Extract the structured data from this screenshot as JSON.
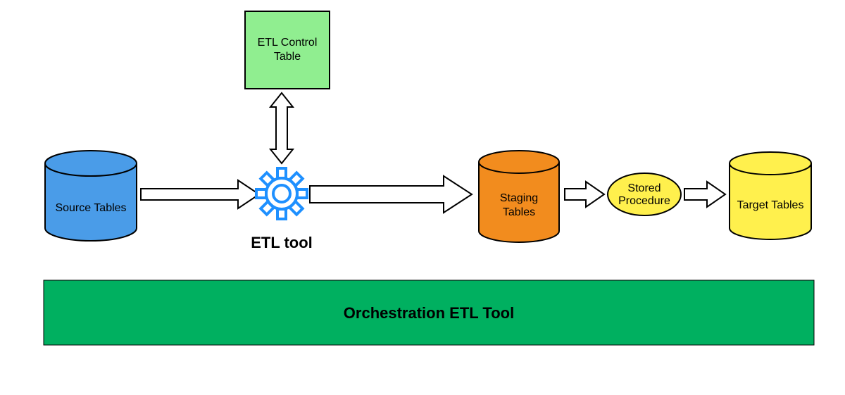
{
  "nodes": {
    "source_tables": {
      "label": "Source Tables",
      "fill": "#4A9CE8",
      "stroke": "#000000"
    },
    "etl_control": {
      "label_line1": "ETL Control",
      "label_line2": "Table",
      "fill": "#90EE90",
      "stroke": "#000000"
    },
    "etl_tool": {
      "label": "ETL tool",
      "color": "#1E90FF"
    },
    "staging": {
      "label_line1": "Staging",
      "label_line2": "Tables",
      "fill": "#F28C1E",
      "stroke": "#000000"
    },
    "stored_proc": {
      "label_line1": "Stored",
      "label_line2": "Procedure",
      "fill": "#FFF04D",
      "stroke": "#000000"
    },
    "target": {
      "label": "Target Tables",
      "fill": "#FFF04D",
      "stroke": "#000000"
    },
    "orchestration": {
      "label": "Orchestration ETL Tool",
      "fill": "#00B060",
      "stroke": "#000000"
    }
  }
}
